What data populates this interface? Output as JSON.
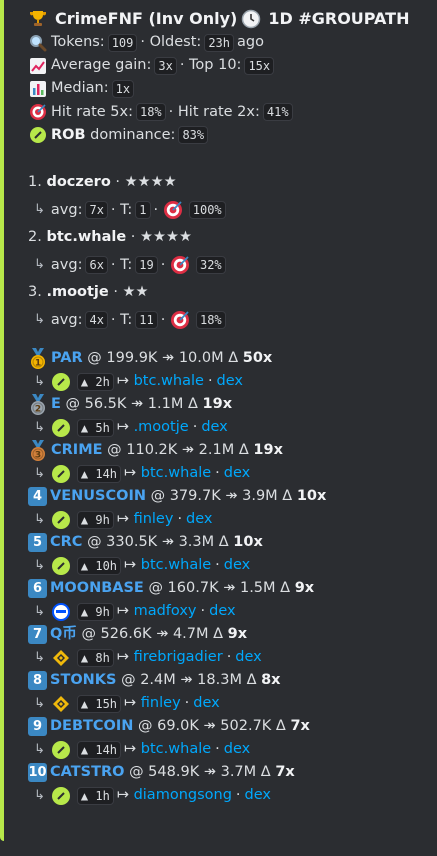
{
  "header": {
    "title": "CrimeFNF (Inv Only)",
    "timeframe": "1D #GROUPATH"
  },
  "stats": {
    "tokens_label": "Tokens:",
    "tokens": "109",
    "oldest_label": "· Oldest:",
    "oldest": "23h",
    "oldest_suffix": "ago",
    "avg_label": "Average gain:",
    "avg": "3x",
    "top10_label": "· Top 10:",
    "top10": "15x",
    "median_label": "Median:",
    "median": "1x",
    "hit5_label": "Hit rate 5x:",
    "hit5": "18%",
    "hit2_label": "· Hit rate 2x:",
    "hit2": "41%",
    "dom_name": "ROB",
    "dom_label": "dominance:",
    "dom": "83%"
  },
  "callers": [
    {
      "rank": "1.",
      "name": "doczero",
      "stars": "· ★★★★",
      "avg_label": "avg:",
      "avg": "7x",
      "t_label": "· T:",
      "t": "1",
      "sep": "·",
      "hit": "100%"
    },
    {
      "rank": "2.",
      "name": "btc.whale",
      "stars": "· ★★★★",
      "avg_label": "avg:",
      "avg": "6x",
      "t_label": "· T:",
      "t": "19",
      "sep": "·",
      "hit": "32%"
    },
    {
      "rank": "3.",
      "name": ".mootje",
      "stars": "· ★★",
      "avg_label": "avg:",
      "avg": "4x",
      "t_label": "· T:",
      "t": "11",
      "sep": "·",
      "hit": "18%"
    }
  ],
  "tokens": [
    {
      "rank": "1",
      "badge": "gold",
      "name": "PAR",
      "entry": "@ 199.9K",
      "arrow": "↠",
      "peak": "10.0M",
      "delta": "Δ",
      "mult": "50x",
      "chain": "sol",
      "age": "▲ 2h",
      "via": "↦",
      "caller": "btc.whale",
      "sep": "·",
      "dex": "dex"
    },
    {
      "rank": "2",
      "badge": "silver",
      "name": "E",
      "entry": "@ 56.5K",
      "arrow": "↠",
      "peak": "1.1M",
      "delta": "Δ",
      "mult": "19x",
      "chain": "sol",
      "age": "▲ 5h",
      "via": "↦",
      "caller": ".mootje",
      "sep": "·",
      "dex": "dex"
    },
    {
      "rank": "3",
      "badge": "bronze",
      "name": "CRIME",
      "entry": "@ 110.2K",
      "arrow": "↠",
      "peak": "2.1M",
      "delta": "Δ",
      "mult": "19x",
      "chain": "sol",
      "age": "▲ 14h",
      "via": "↦",
      "caller": "btc.whale",
      "sep": "·",
      "dex": "dex"
    },
    {
      "rank": "4",
      "badge": "num",
      "name": "VENUSCOIN",
      "entry": "@ 379.7K",
      "arrow": "↠",
      "peak": "3.9M",
      "delta": "Δ",
      "mult": "10x",
      "chain": "sol",
      "age": "▲ 9h",
      "via": "↦",
      "caller": "finley",
      "sep": "·",
      "dex": "dex"
    },
    {
      "rank": "5",
      "badge": "num",
      "name": "CRC",
      "entry": "@ 330.5K",
      "arrow": "↠",
      "peak": "3.3M",
      "delta": "Δ",
      "mult": "10x",
      "chain": "sol",
      "age": "▲ 10h",
      "via": "↦",
      "caller": "btc.whale",
      "sep": "·",
      "dex": "dex"
    },
    {
      "rank": "6",
      "badge": "num",
      "name": "MOONBASE",
      "entry": "@ 160.7K",
      "arrow": "↠",
      "peak": "1.5M",
      "delta": "Δ",
      "mult": "9x",
      "chain": "base",
      "age": "▲ 9h",
      "via": "↦",
      "caller": "madfoxy",
      "sep": "·",
      "dex": "dex"
    },
    {
      "rank": "7",
      "badge": "num",
      "name": "Q币",
      "entry": "@ 526.6K",
      "arrow": "↠",
      "peak": "4.7M",
      "delta": "Δ",
      "mult": "9x",
      "chain": "bsc",
      "age": "▲ 8h",
      "via": "↦",
      "caller": "firebrigadier",
      "sep": "·",
      "dex": "dex"
    },
    {
      "rank": "8",
      "badge": "num",
      "name": "STONKS",
      "entry": "@ 2.4M",
      "arrow": "↠",
      "peak": "18.3M",
      "delta": "Δ",
      "mult": "8x",
      "chain": "bsc",
      "age": "▲ 15h",
      "via": "↦",
      "caller": "finley",
      "sep": "·",
      "dex": "dex"
    },
    {
      "rank": "9",
      "badge": "num",
      "name": "DEBTCOIN",
      "entry": "@ 69.0K",
      "arrow": "↠",
      "peak": "502.7K",
      "delta": "Δ",
      "mult": "7x",
      "chain": "sol",
      "age": "▲ 14h",
      "via": "↦",
      "caller": "btc.whale",
      "sep": "·",
      "dex": "dex"
    },
    {
      "rank": "10",
      "badge": "num",
      "name": "CATSTRO",
      "entry": "@ 548.9K",
      "arrow": "↠",
      "peak": "3.7M",
      "delta": "Δ",
      "mult": "7x",
      "chain": "sol",
      "age": "▲ 1h",
      "via": "↦",
      "caller": "diamongsong",
      "sep": "·",
      "dex": "dex"
    }
  ],
  "colors": {
    "accent_bar": "#b7e84a",
    "link": "#00a8fc",
    "token": "#4aa3f0",
    "number_badge": "#3b88c3",
    "gold": "#f4b400",
    "silver": "#9aa4ad",
    "bronze": "#d2803a"
  }
}
